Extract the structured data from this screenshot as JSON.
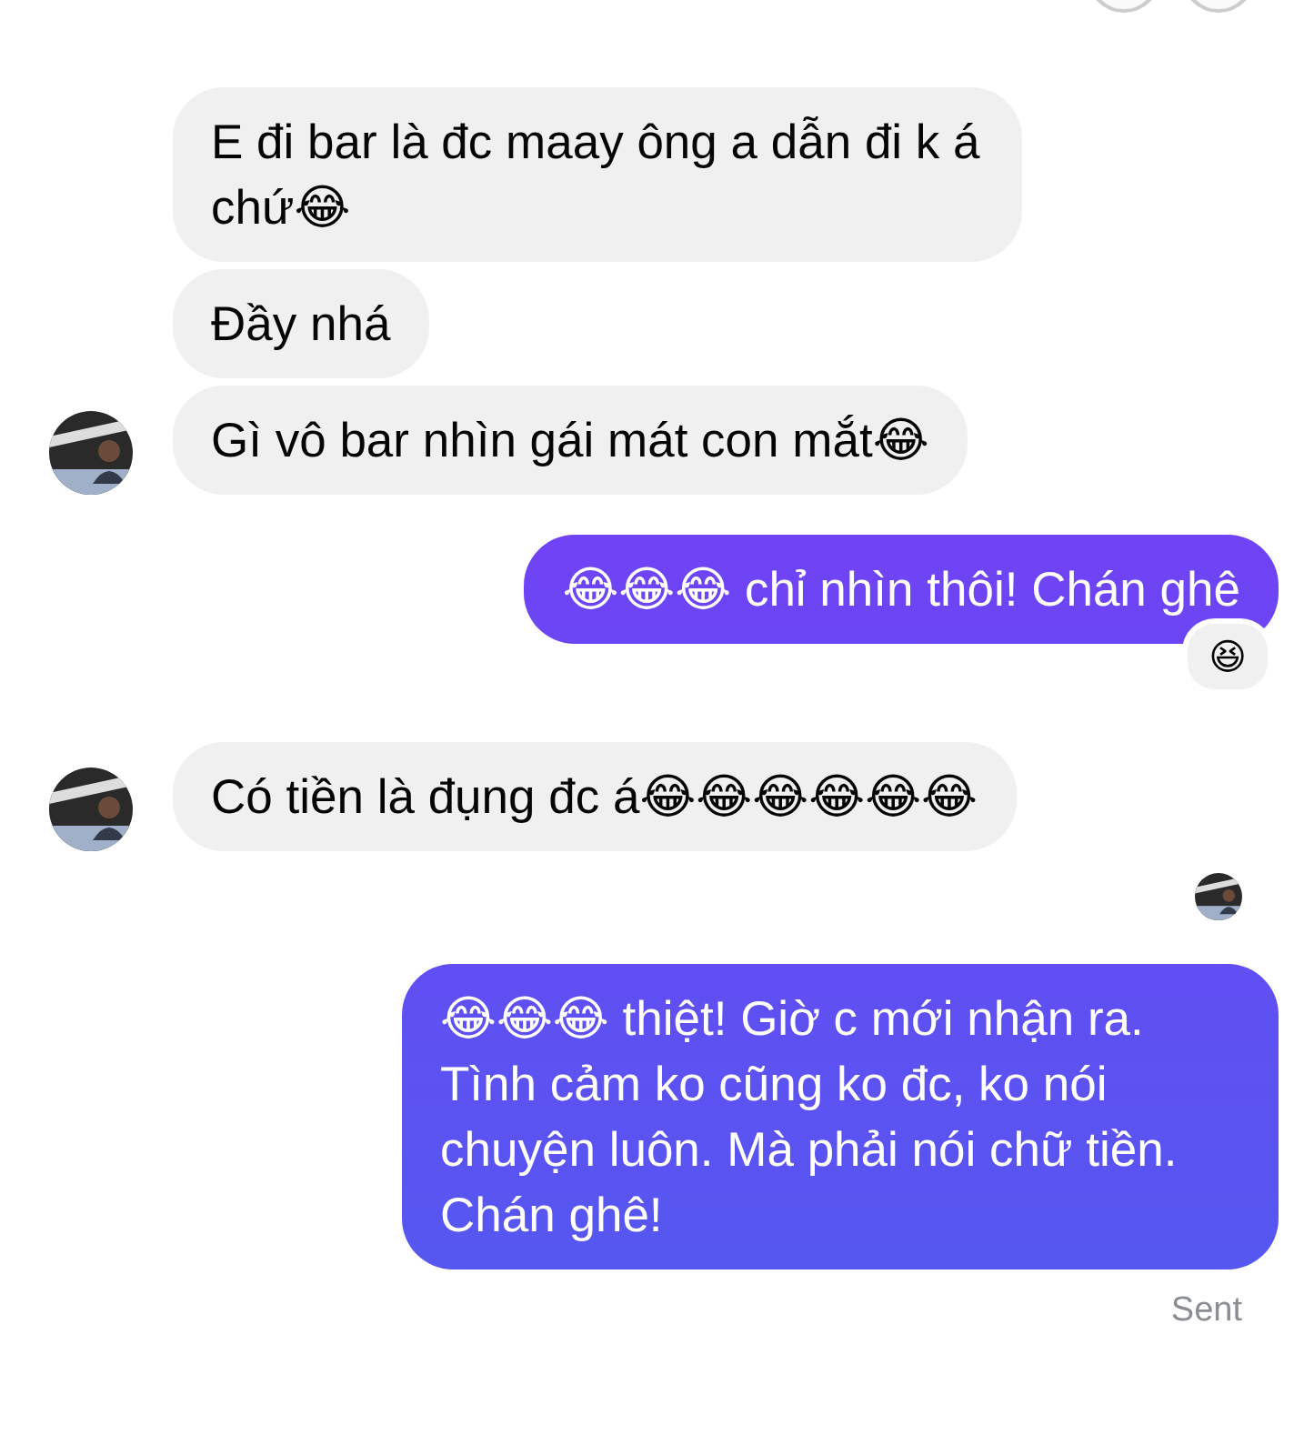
{
  "messages": [
    {
      "kind": "incoming",
      "text": "E đi bar là đc maay ông a dẫn đi k á chứ😂",
      "avatar": false
    },
    {
      "kind": "incoming",
      "text": "Đầy nhá",
      "avatar": false
    },
    {
      "kind": "incoming",
      "text": "Gì vô bar nhìn gái mát con mắt😂",
      "avatar": true
    },
    {
      "kind": "outgoing",
      "text": "😂😂😂 chỉ nhìn thôi! Chán ghê",
      "reaction": "😆"
    },
    {
      "kind": "incoming",
      "text": "Có tiền là đụng đc á😂😂😂😂😂😂",
      "avatar": true
    },
    {
      "kind": "seen"
    },
    {
      "kind": "outgoing",
      "text": "😂😂😂 thiệt! Giờ c mới nhận ra. Tình cảm ko cũng ko đc, ko nói chuyện luôn. Mà phải nói chữ tiền. Chán ghê!"
    }
  ],
  "status": "Sent"
}
